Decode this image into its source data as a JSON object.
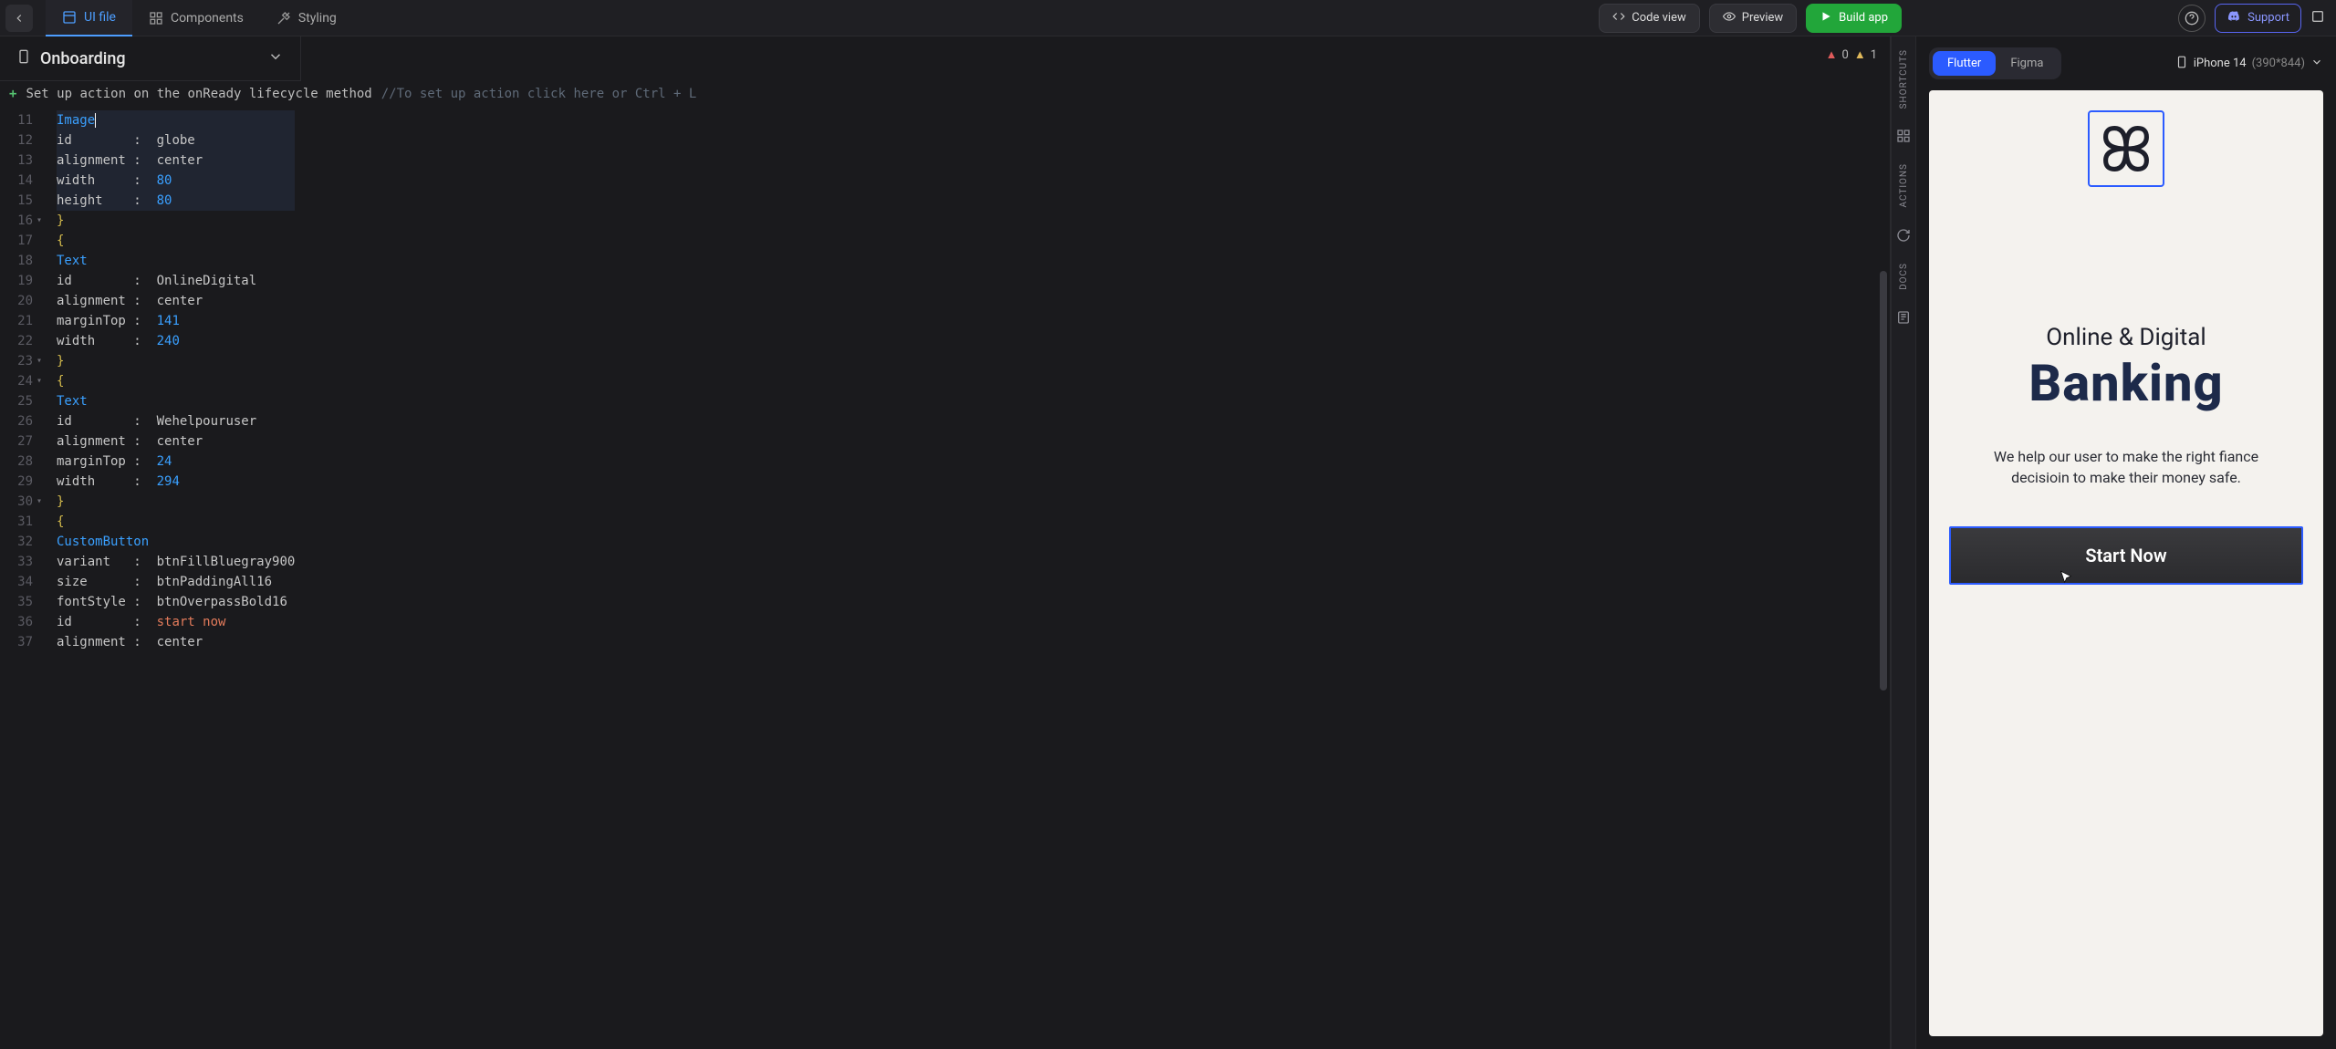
{
  "topbar": {
    "tabs": [
      {
        "label": "UI file",
        "active": true
      },
      {
        "label": "Components",
        "active": false
      },
      {
        "label": "Styling",
        "active": false
      }
    ],
    "codeView": "Code view",
    "preview": "Preview",
    "build": "Build app",
    "support": "Support"
  },
  "fileHeader": {
    "name": "Onboarding",
    "errors": "0",
    "warnings": "1"
  },
  "actionHint": {
    "text": "Set up action on the onReady lifecycle method",
    "comment": "//To set up action click here or Ctrl + L"
  },
  "code": {
    "startLine": 11,
    "lines": [
      {
        "n": 11,
        "hl": true,
        "indent": 2,
        "kind": "kw",
        "t": "Image"
      },
      {
        "n": 12,
        "hl": true,
        "indent": 2,
        "kind": "prop",
        "p": "id",
        "v": "globe"
      },
      {
        "n": 13,
        "hl": true,
        "indent": 2,
        "kind": "prop",
        "p": "alignment",
        "v": "center"
      },
      {
        "n": 14,
        "hl": true,
        "indent": 2,
        "kind": "prop",
        "p": "width",
        "v": "80",
        "num": true
      },
      {
        "n": 15,
        "hl": true,
        "indent": 2,
        "kind": "prop",
        "p": "height",
        "v": "80",
        "num": true
      },
      {
        "n": 16,
        "fold": true,
        "indent": 1,
        "kind": "br",
        "t": "}"
      },
      {
        "n": 17,
        "indent": 1,
        "kind": "br",
        "t": "{"
      },
      {
        "n": 18,
        "indent": 2,
        "kind": "kw",
        "t": "Text"
      },
      {
        "n": 19,
        "indent": 2,
        "kind": "prop",
        "p": "id",
        "v": "OnlineDigital"
      },
      {
        "n": 20,
        "indent": 2,
        "kind": "prop",
        "p": "alignment",
        "v": "center"
      },
      {
        "n": 21,
        "indent": 2,
        "kind": "prop",
        "p": "marginTop",
        "v": "141",
        "num": true
      },
      {
        "n": 22,
        "indent": 2,
        "kind": "prop",
        "p": "width",
        "v": "240",
        "num": true
      },
      {
        "n": 23,
        "fold": true,
        "indent": 1,
        "kind": "br",
        "t": "}"
      },
      {
        "n": 24,
        "fold": true,
        "indent": 1,
        "kind": "br",
        "t": "{"
      },
      {
        "n": 25,
        "indent": 2,
        "kind": "kw",
        "t": "Text"
      },
      {
        "n": 26,
        "indent": 2,
        "kind": "prop",
        "p": "id",
        "v": "Wehelpouruser"
      },
      {
        "n": 27,
        "indent": 2,
        "kind": "prop",
        "p": "alignment",
        "v": "center"
      },
      {
        "n": 28,
        "indent": 2,
        "kind": "prop",
        "p": "marginTop",
        "v": "24",
        "num": true
      },
      {
        "n": 29,
        "indent": 2,
        "kind": "prop",
        "p": "width",
        "v": "294",
        "num": true
      },
      {
        "n": 30,
        "fold": true,
        "indent": 1,
        "kind": "br",
        "t": "}"
      },
      {
        "n": 31,
        "indent": 1,
        "kind": "br",
        "t": "{"
      },
      {
        "n": 32,
        "indent": 2,
        "kind": "kw",
        "t": "CustomButton"
      },
      {
        "n": 33,
        "indent": 2,
        "kind": "prop",
        "p": "variant",
        "v": "btnFillBluegray900"
      },
      {
        "n": 34,
        "indent": 2,
        "kind": "prop",
        "p": "size",
        "v": "btnPaddingAll16"
      },
      {
        "n": 35,
        "indent": 2,
        "kind": "prop",
        "p": "fontStyle",
        "v": "btnOverpassBold16"
      },
      {
        "n": 36,
        "indent": 2,
        "kind": "prop",
        "p": "id",
        "v": "start now",
        "str": true
      },
      {
        "n": 37,
        "indent": 2,
        "kind": "prop",
        "p": "alignment",
        "v": "center",
        "cut": true
      }
    ]
  },
  "sidebar": {
    "items": [
      "SHORTCUTS",
      "ACTIONS",
      "DOCS"
    ]
  },
  "preview": {
    "seg": {
      "flutter": "Flutter",
      "figma": "Figma"
    },
    "device": {
      "name": "iPhone 14",
      "dims": "(390*844)"
    },
    "onboarding": {
      "title": "Online & Digital",
      "big": "Banking",
      "sub": "We help our user to make the right fiance decisioin to make their money safe.",
      "cta": "Start Now"
    }
  }
}
